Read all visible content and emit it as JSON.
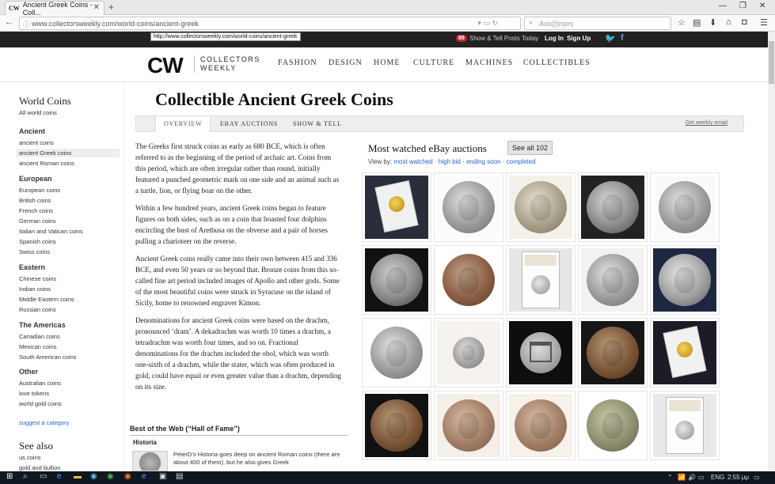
{
  "browser": {
    "tab_title": "Ancient Greek Coins - Coll...",
    "tab_favicon": "CW",
    "url": "www.collectorsweekly.com/world-coins/ancient-greek",
    "search_placeholder": "Αναζήτηση",
    "tooltip_url": "http://www.collectorsweekly.com/world-coins/ancient-greek"
  },
  "sitebar": {
    "badge_count": "89",
    "showtell_label": "Show & Tell Posts Today",
    "login_label": "Log In",
    "signup_label": "Sign Up"
  },
  "header": {
    "logo_mark": "CW",
    "logo_line1": "COLLECTORS",
    "logo_line2": "WEEKLY",
    "nav": [
      "FASHION",
      "DESIGN",
      "HOME",
      "CULTURE",
      "MACHINES",
      "COLLECTIBLES"
    ]
  },
  "sidebar": {
    "title": "World Coins",
    "all_link": "All world coins",
    "groups": [
      {
        "heading": "Ancient",
        "links": [
          "ancient coins",
          "ancient Greek coins",
          "ancient Roman coins"
        ]
      },
      {
        "heading": "European",
        "links": [
          "European coins",
          "British coins",
          "French coins",
          "German coins",
          "Italian and Vatican coins",
          "Spanish coins",
          "Swiss coins"
        ]
      },
      {
        "heading": "Eastern",
        "links": [
          "Chinese coins",
          "Indian coins",
          "Middle Eastern coins",
          "Russian coins"
        ]
      },
      {
        "heading": "The Americas",
        "links": [
          "Canadian coins",
          "Mexican coins",
          "South American coins"
        ]
      },
      {
        "heading": "Other",
        "links": [
          "Australian coins",
          "love tokens",
          "world gold coins"
        ]
      }
    ],
    "suggest_label": "suggest a category",
    "see_also_title": "See also",
    "see_also_links": [
      "us coins",
      "gold and bullion"
    ]
  },
  "main": {
    "title": "Collectible Ancient Greek Coins",
    "tabs": [
      "OVERVIEW",
      "EBAY AUCTIONS",
      "SHOW & TELL"
    ],
    "weekly_email": "Get weekly email",
    "paragraphs": [
      "The Greeks first struck coins as early as 680 BCE, which is often referred to as the beginning of the period of archaic art. Coins from this period, which are often irregular rather than round, initially featured a punched geometric mark on one side and an animal such as a turtle, lion, or flying boar on the other.",
      "Within a few hundred years, ancient Greek coins began to feature figures on both sides, such as on a coin that boasted four dolphins encircling the bust of Arethusa on the obverse and a pair of horses pulling a charioteer on the reverse.",
      "Ancient Greek coins really came into their own between 415 and 336 BCE, and even 50 years or so beyond that. Bronze coins from this so-called fine art period included images of Apollo and other gods. Some of the most beautiful coins were struck in Syracuse on the island of Sicily, home to renowned engraver Kimon.",
      "Denominations for ancient Greek coins were based on the drachm, pronounced ‘dram’. A dekadrachm was worth 10 times a drachm, a tetradrachm was worth four times, and so on. Fractional denominations for the drachm included the obol, which was worth one-sixth of a drachm, while the stater, which was often produced in gold, could have equal or even greater value than a drachm, depending on its size."
    ],
    "best_of_web": "Best of the Web (“Hall of Fame”)",
    "historia_title": "Historia",
    "historia_text": "PeterD’s Historia goes deep on ancient Roman coins (there are about 400 of them), but he also gives Greek"
  },
  "ebay": {
    "title": "Most watched eBay auctions",
    "see_all": "See all 102",
    "view_by_label": "View by:",
    "view_by_links": [
      "most watched",
      "high bid",
      "ending soon",
      "completed"
    ],
    "items": [
      {
        "kind": "slab-gold",
        "bg": "#2a2d3a"
      },
      {
        "kind": "silver",
        "bg": "#fbfbfb"
      },
      {
        "kind": "silver-warm",
        "bg": "#f4f1ea"
      },
      {
        "kind": "silver-dark",
        "bg": "#222"
      },
      {
        "kind": "silver",
        "bg": "#fafafa"
      },
      {
        "kind": "dark-silver",
        "bg": "#111"
      },
      {
        "kind": "bronze",
        "bg": "#fff"
      },
      {
        "kind": "ngc",
        "bg": "#e6e6e6"
      },
      {
        "kind": "silver",
        "bg": "#f2f2f2"
      },
      {
        "kind": "blue-silver",
        "bg": "#1d2740"
      },
      {
        "kind": "silver",
        "bg": "#fff"
      },
      {
        "kind": "silver-small",
        "bg": "#f6f2ee"
      },
      {
        "kind": "temple",
        "bg": "#0e0e0e"
      },
      {
        "kind": "bronze-dark",
        "bg": "#161616"
      },
      {
        "kind": "slab-gold",
        "bg": "#1c1c26"
      },
      {
        "kind": "bronze-dark",
        "bg": "#111"
      },
      {
        "kind": "bronze-light",
        "bg": "#f4efe8"
      },
      {
        "kind": "bronze-light",
        "bg": "#f6f1eb"
      },
      {
        "kind": "green-bronze",
        "bg": "#fff"
      },
      {
        "kind": "ngc",
        "bg": "#e9e9e9"
      }
    ]
  },
  "taskbar": {
    "lang": "ENG",
    "time": "2:55 μμ"
  }
}
